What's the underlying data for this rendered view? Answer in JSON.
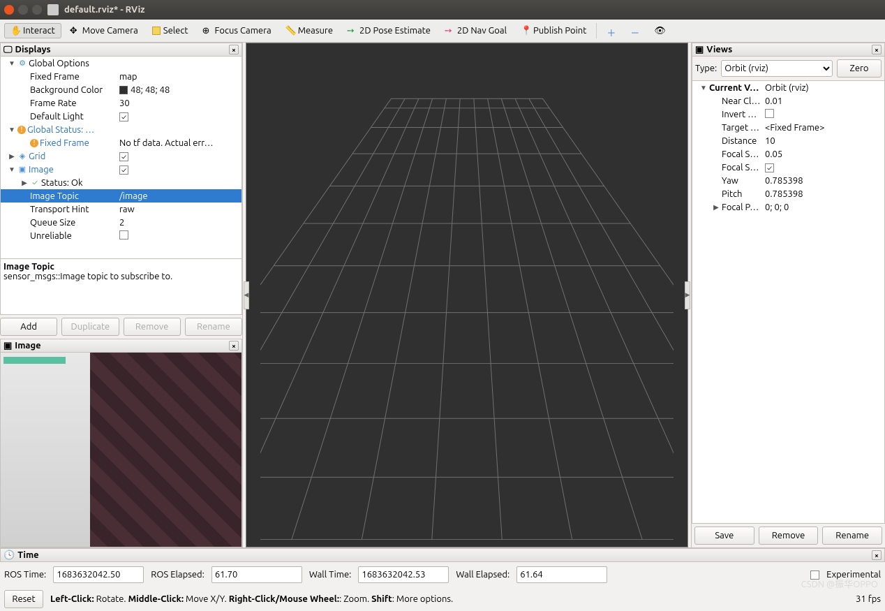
{
  "window": {
    "title": "default.rviz* - RViz"
  },
  "toolbar": {
    "interact": "Interact",
    "move_camera": "Move Camera",
    "select": "Select",
    "focus_camera": "Focus Camera",
    "measure": "Measure",
    "pose_estimate": "2D Pose Estimate",
    "nav_goal": "2D Nav Goal",
    "publish_point": "Publish Point"
  },
  "displays": {
    "title": "Displays",
    "items": [
      {
        "key": "Global Options",
        "val": "",
        "kind": "group",
        "exp": true,
        "icon": "gear",
        "depth": 0
      },
      {
        "key": "Fixed Frame",
        "val": "map",
        "depth": 1
      },
      {
        "key": "Background Color",
        "val": "48; 48; 48",
        "swatch": true,
        "depth": 1
      },
      {
        "key": "Frame Rate",
        "val": "30",
        "depth": 1
      },
      {
        "key": "Default Light",
        "val": "",
        "check": true,
        "checked": true,
        "depth": 1
      },
      {
        "key": "Global Status: …",
        "val": "",
        "link": true,
        "icon": "warn",
        "exp": true,
        "depth": 0
      },
      {
        "key": "Fixed Frame",
        "val": "No tf data.  Actual err…",
        "link": true,
        "icon": "warn",
        "depth": 1
      },
      {
        "key": "Grid",
        "val": "",
        "link": true,
        "icon": "grid",
        "check": true,
        "checked": true,
        "collapsed": true,
        "depth": 0
      },
      {
        "key": "Image",
        "val": "",
        "link": true,
        "icon": "img",
        "check": true,
        "checked": true,
        "exp": true,
        "bold": true,
        "depth": 0
      },
      {
        "key": "Status: Ok",
        "val": "",
        "icon": "ok",
        "collapsed": true,
        "depth": 1
      },
      {
        "key": "Image Topic",
        "val": "/image",
        "sel": true,
        "depth": 1
      },
      {
        "key": "Transport Hint",
        "val": "raw",
        "depth": 1
      },
      {
        "key": "Queue Size",
        "val": "2",
        "depth": 1
      },
      {
        "key": "Unreliable",
        "val": "",
        "check": true,
        "checked": false,
        "depth": 1
      }
    ],
    "desc": {
      "title": "Image Topic",
      "body": "sensor_msgs::Image topic to subscribe to."
    },
    "buttons": {
      "add": "Add",
      "dup": "Duplicate",
      "remove": "Remove",
      "rename": "Rename"
    }
  },
  "image_panel": {
    "title": "Image"
  },
  "views": {
    "title": "Views",
    "type_label": "Type:",
    "type_value": "Orbit (rviz)",
    "zero": "Zero",
    "items": [
      {
        "key": "Current V…",
        "val": "Orbit (rviz)",
        "bold": true,
        "exp": true,
        "depth": 0
      },
      {
        "key": "Near Cl…",
        "val": "0.01",
        "depth": 1
      },
      {
        "key": "Invert …",
        "val": "",
        "check": true,
        "checked": false,
        "depth": 1
      },
      {
        "key": "Target …",
        "val": "<Fixed Frame>",
        "depth": 1
      },
      {
        "key": "Distance",
        "val": "10",
        "depth": 1
      },
      {
        "key": "Focal S…",
        "val": "0.05",
        "depth": 1
      },
      {
        "key": "Focal S…",
        "val": "",
        "check": true,
        "checked": true,
        "depth": 1
      },
      {
        "key": "Yaw",
        "val": "0.785398",
        "depth": 1
      },
      {
        "key": "Pitch",
        "val": "0.785398",
        "depth": 1
      },
      {
        "key": "Focal P…",
        "val": "0; 0; 0",
        "collapsed": true,
        "depth": 1
      }
    ],
    "buttons": {
      "save": "Save",
      "remove": "Remove",
      "rename": "Rename"
    }
  },
  "time": {
    "title": "Time",
    "ros_time_label": "ROS Time:",
    "ros_time": "1683632042.50",
    "ros_elapsed_label": "ROS Elapsed:",
    "ros_elapsed": "61.70",
    "wall_time_label": "Wall Time:",
    "wall_time": "1683632042.53",
    "wall_elapsed_label": "Wall Elapsed:",
    "wall_elapsed": "61.64",
    "experimental": "Experimental"
  },
  "status": {
    "reset": "Reset",
    "hint_left": "Left-Click:",
    "hint_left_v": " Rotate. ",
    "hint_mid": "Middle-Click:",
    "hint_mid_v": " Move X/Y. ",
    "hint_right": "Right-Click/Mouse Wheel:",
    "hint_right_v": ": Zoom. ",
    "hint_shift": "Shift",
    "hint_shift_v": ": More options.",
    "fps": "31 fps"
  },
  "watermark": "CSDN @振华OPPO"
}
